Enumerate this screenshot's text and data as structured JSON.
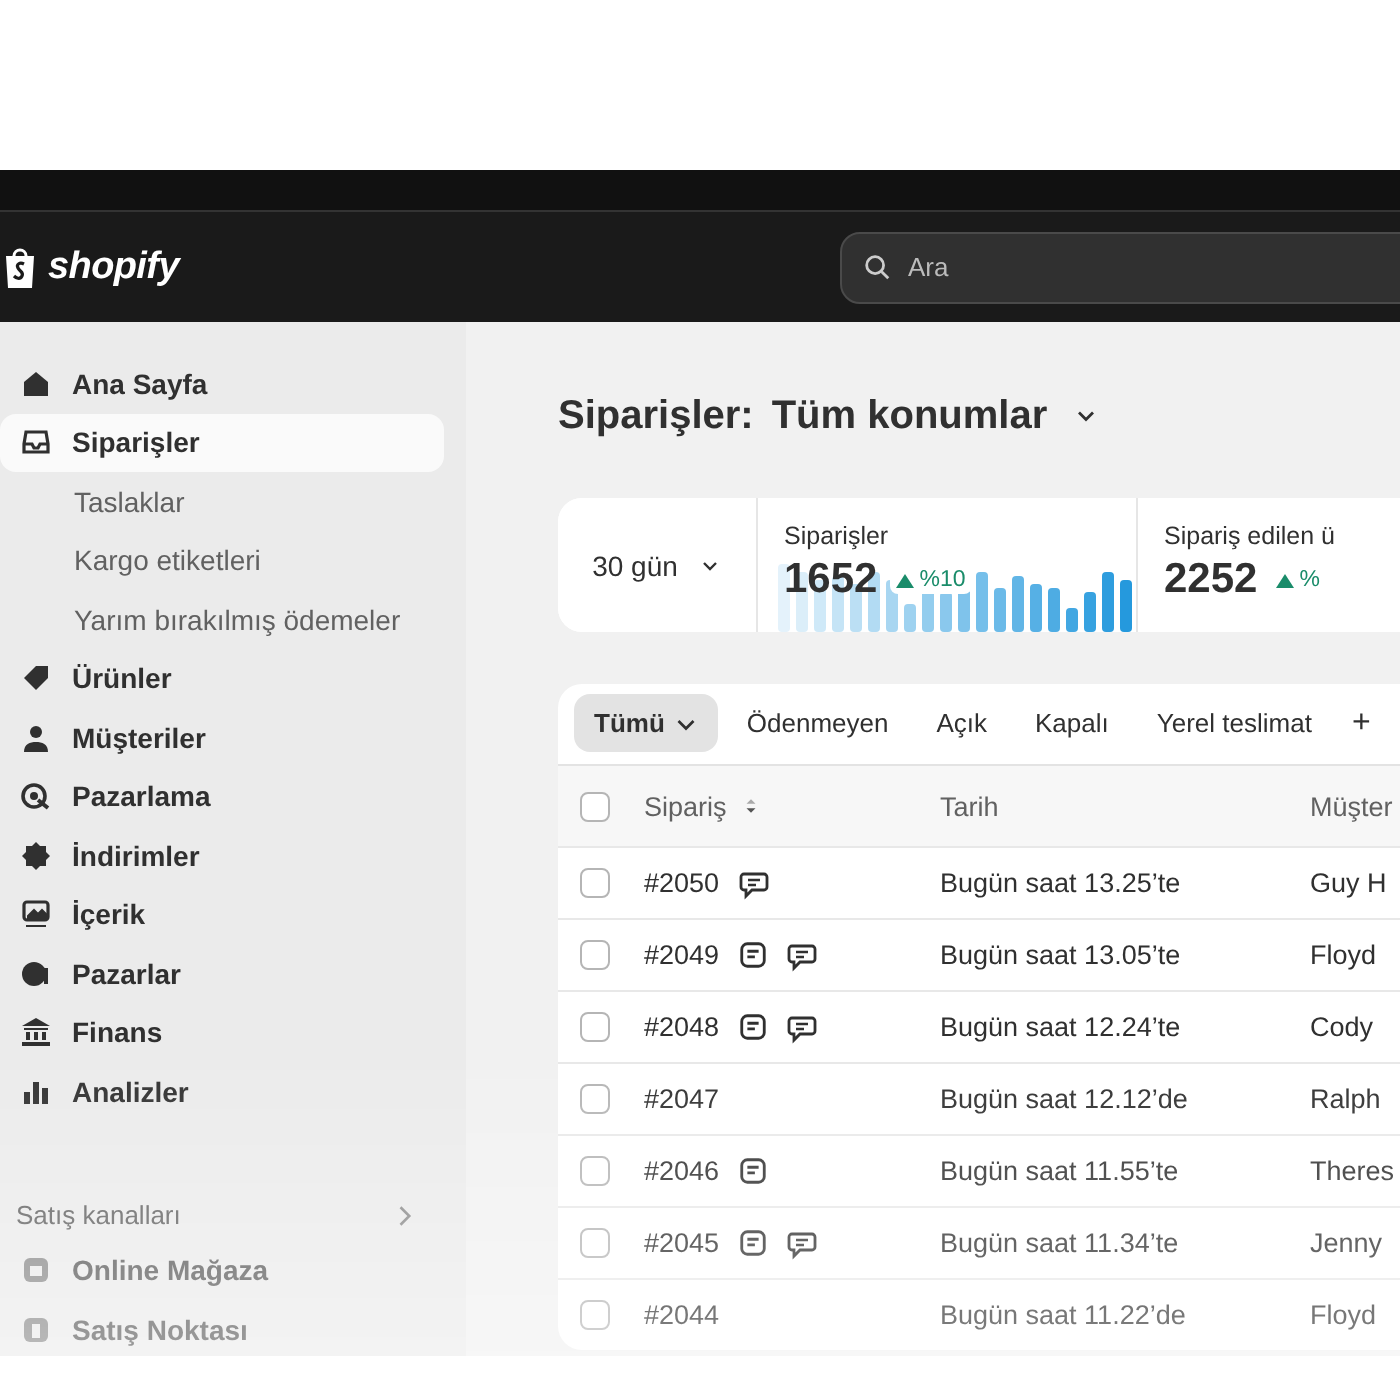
{
  "topbar": {
    "logo": "shopify",
    "search": {
      "placeholder": "Ara"
    }
  },
  "sidebar": {
    "items": [
      {
        "label": "Ana Sayfa",
        "selected": false
      },
      {
        "label": "Siparişler",
        "selected": true,
        "children": [
          {
            "label": "Taslaklar"
          },
          {
            "label": "Kargo etiketleri"
          },
          {
            "label": "Yarım bırakılmış ödemeler"
          }
        ]
      },
      {
        "label": "Ürünler",
        "selected": false
      },
      {
        "label": "Müşteriler",
        "selected": false
      },
      {
        "label": "Pazarlama",
        "selected": false
      },
      {
        "label": "İndirimler",
        "selected": false
      },
      {
        "label": "İçerik",
        "selected": false
      },
      {
        "label": "Pazarlar",
        "selected": false
      },
      {
        "label": "Finans",
        "selected": false
      },
      {
        "label": "Analizler",
        "selected": false
      }
    ],
    "section": {
      "title": "Satış kanalları",
      "items": [
        {
          "label": "Online Mağaza"
        },
        {
          "label": "Satış Noktası"
        }
      ]
    }
  },
  "page": {
    "title": "Siparişler:",
    "location": "Tüm konumlar"
  },
  "stats": {
    "period": "30 gün",
    "cards": [
      {
        "label": "Siparişler",
        "value": "1652",
        "change": "%10"
      },
      {
        "label": "Sipariş edilen ü",
        "value": "2252",
        "change": "%"
      }
    ]
  },
  "filters": [
    {
      "label": "Tümü",
      "selected": true
    },
    {
      "label": "Ödenmeyen",
      "selected": false
    },
    {
      "label": "Açık",
      "selected": false
    },
    {
      "label": "Kapalı",
      "selected": false
    },
    {
      "label": "Yerel teslimat",
      "selected": false
    }
  ],
  "add_filter": "+",
  "table": {
    "all_checked": false,
    "columns": [
      "Sipariş",
      "Tarih",
      "Müşter"
    ],
    "rows": [
      {
        "order": "#2050",
        "note": false,
        "comment": true,
        "date": "Bugün saat 13.25’te",
        "customer": "Guy H",
        "checked": false
      },
      {
        "order": "#2049",
        "note": true,
        "comment": true,
        "date": "Bugün saat 13.05’te",
        "customer": "Floyd",
        "checked": false
      },
      {
        "order": "#2048",
        "note": true,
        "comment": true,
        "date": "Bugün saat 12.24’te",
        "customer": "Cody",
        "checked": false
      },
      {
        "order": "#2047",
        "note": false,
        "comment": false,
        "date": "Bugün saat 12.12’de",
        "customer": "Ralph",
        "checked": false
      },
      {
        "order": "#2046",
        "note": true,
        "comment": false,
        "date": "Bugün saat 11.55’te",
        "customer": "Theres",
        "checked": false
      },
      {
        "order": "#2045",
        "note": true,
        "comment": true,
        "date": "Bugün saat 11.34’te",
        "customer": "Jenny",
        "checked": false
      },
      {
        "order": "#2044",
        "note": false,
        "comment": false,
        "date": "Bugün saat 11.22’de",
        "customer": "Floyd",
        "checked": false
      }
    ]
  }
}
